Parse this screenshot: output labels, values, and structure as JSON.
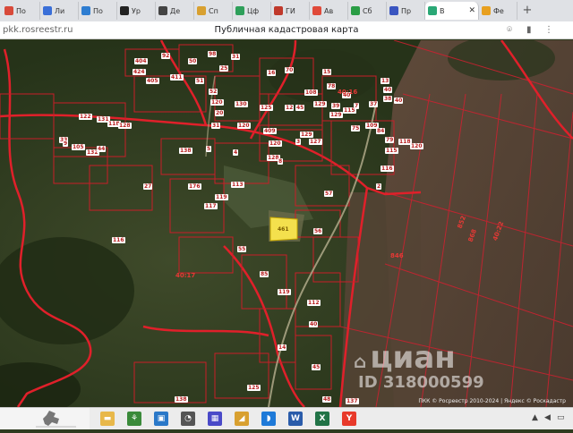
{
  "browser": {
    "tabs": [
      {
        "label": "По",
        "color": "#d84a3a"
      },
      {
        "label": "Ли",
        "color": "#3a6fd8"
      },
      {
        "label": "По",
        "color": "#2e7dd1"
      },
      {
        "label": "Ур",
        "color": "#222222"
      },
      {
        "label": "Де",
        "color": "#444444"
      },
      {
        "label": "Сп",
        "color": "#d8a030"
      },
      {
        "label": "Цф",
        "color": "#2e9f5a"
      },
      {
        "label": "ГИ",
        "color": "#c0392b"
      },
      {
        "label": "Ав",
        "color": "#e04a3a"
      },
      {
        "label": "Сб",
        "color": "#2a9d45"
      },
      {
        "label": "Пр",
        "color": "#3a55c0"
      },
      {
        "label": "В",
        "color": "#2aa876",
        "active": true
      },
      {
        "label": "Фе",
        "color": "#e8a020"
      }
    ],
    "new_tab": "+",
    "url": "pkk.rosreestr.ru",
    "page_title": "Публичная кадастровая карта"
  },
  "map": {
    "labels": [
      {
        "t": "404"
      },
      {
        "t": "92"
      },
      {
        "t": "50"
      },
      {
        "t": "98"
      },
      {
        "t": "25"
      },
      {
        "t": "31"
      },
      {
        "t": "424"
      },
      {
        "t": "405"
      },
      {
        "t": "411"
      },
      {
        "t": "51"
      },
      {
        "t": "52"
      },
      {
        "t": "16"
      },
      {
        "t": "70"
      },
      {
        "t": "15"
      },
      {
        "t": "78"
      },
      {
        "t": "40"
      },
      {
        "t": "13"
      },
      {
        "t": "40"
      },
      {
        "t": "108"
      },
      {
        "t": "120"
      },
      {
        "t": "130"
      },
      {
        "t": "125"
      },
      {
        "t": "12"
      },
      {
        "t": "45"
      },
      {
        "t": "129"
      },
      {
        "t": "39"
      },
      {
        "t": "7"
      },
      {
        "t": "37"
      },
      {
        "t": "38"
      },
      {
        "t": "40"
      },
      {
        "t": "129"
      },
      {
        "t": "115"
      },
      {
        "t": "75"
      },
      {
        "t": "109"
      },
      {
        "t": "84"
      },
      {
        "t": "79"
      },
      {
        "t": "118"
      },
      {
        "t": "120"
      },
      {
        "t": "20"
      },
      {
        "t": "31"
      },
      {
        "t": "120"
      },
      {
        "t": "409"
      },
      {
        "t": "129"
      },
      {
        "t": "127"
      },
      {
        "t": "120"
      },
      {
        "t": "122"
      },
      {
        "t": "131"
      },
      {
        "t": "118"
      },
      {
        "t": "128"
      },
      {
        "t": "33"
      },
      {
        "t": "9"
      },
      {
        "t": "105"
      },
      {
        "t": "132"
      },
      {
        "t": "44"
      },
      {
        "t": "138"
      },
      {
        "t": "5"
      },
      {
        "t": "4"
      },
      {
        "t": "128"
      },
      {
        "t": "3"
      },
      {
        "t": "8"
      },
      {
        "t": "115"
      },
      {
        "t": "116"
      },
      {
        "t": "2"
      },
      {
        "t": "27"
      },
      {
        "t": "176"
      },
      {
        "t": "113"
      },
      {
        "t": "119"
      },
      {
        "t": "117"
      },
      {
        "t": "57"
      },
      {
        "t": "56"
      },
      {
        "t": "55"
      },
      {
        "t": "85"
      },
      {
        "t": "119"
      },
      {
        "t": "112"
      },
      {
        "t": "40"
      },
      {
        "t": "14"
      },
      {
        "t": "45"
      },
      {
        "t": "125"
      },
      {
        "t": "48"
      },
      {
        "t": "137"
      },
      {
        "t": "138"
      },
      {
        "t": "116"
      }
    ],
    "big_labels": [
      {
        "t": "40:16"
      },
      {
        "t": "40:17"
      },
      {
        "t": "846"
      },
      {
        "t": "852"
      },
      {
        "t": "868"
      },
      {
        "t": "40:22"
      }
    ],
    "selected_parcel": "461",
    "watermark_brand": "циан",
    "watermark_id": "ID 318000599",
    "copyright": "ПКК © Росреестр 2010-2024 | Яндекс © Роскадастр"
  },
  "taskbar": {
    "icons": [
      {
        "name": "explorer",
        "color": "#e8b84a",
        "glyph": "▬"
      },
      {
        "name": "xbox",
        "color": "#3a8a3a",
        "glyph": "⚘"
      },
      {
        "name": "photos",
        "color": "#2a78c8",
        "glyph": "▣"
      },
      {
        "name": "store",
        "color": "#555555",
        "glyph": "◔"
      },
      {
        "name": "media",
        "color": "#4a4ac8",
        "glyph": "▦"
      },
      {
        "name": "paint",
        "color": "#d8a030",
        "glyph": "◢"
      },
      {
        "name": "edge",
        "color": "#1e7ad8",
        "glyph": "◗"
      },
      {
        "name": "word",
        "color": "#2a5caa",
        "glyph": "W"
      },
      {
        "name": "excel",
        "color": "#217346",
        "glyph": "X"
      },
      {
        "name": "yandex",
        "color": "#e83a2a",
        "glyph": "Y"
      }
    ]
  }
}
